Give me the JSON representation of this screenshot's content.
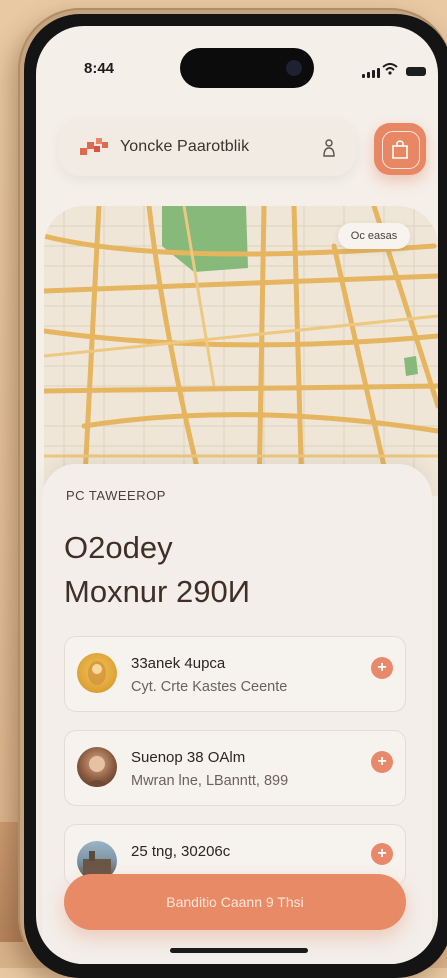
{
  "status": {
    "time": "8:44"
  },
  "header": {
    "title": "Yoncke Paarotblik",
    "logo_icon": "brand-logo-icon",
    "user_icon": "person-icon",
    "action_icon": "bag-icon"
  },
  "map": {
    "label": "Oc easas"
  },
  "sheet": {
    "eyebrow": "PC TAWEEROP",
    "heading_line1": "O2odey",
    "heading_line2": "Moxnur 290И"
  },
  "items": [
    {
      "title": "33anek 4upca",
      "subtitle": "Cyt. Crte Kastes Ceente"
    },
    {
      "title": "Suenop 38 OAlm",
      "subtitle": "Mwran lne, LBanntt, 899"
    },
    {
      "title": "25 tng, 30206c",
      "subtitle": ""
    }
  ],
  "cta": {
    "label": "Banditio Caann 9 Thsi"
  },
  "colors": {
    "accent": "#e88764",
    "road": "#e5b560",
    "park": "#86b97a"
  }
}
